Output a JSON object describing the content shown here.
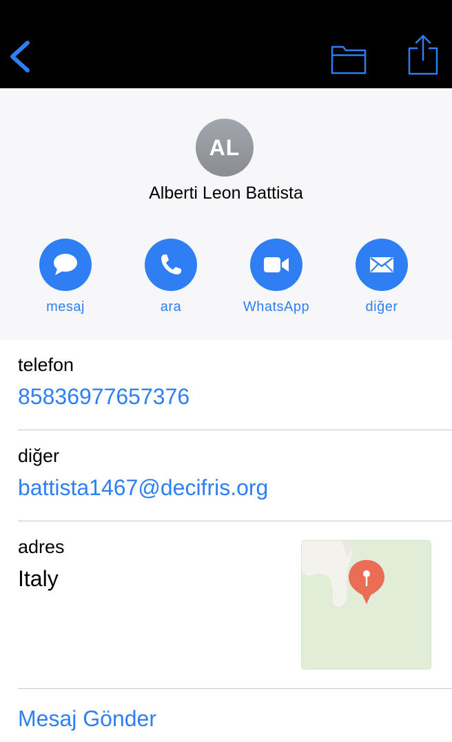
{
  "nav": {
    "back_icon": "chevron-left-icon",
    "folder_icon": "folder-icon",
    "share_icon": "share-icon",
    "accent": "#2f7ff4"
  },
  "contact": {
    "initials": "AL",
    "name": "Alberti Leon Battista"
  },
  "actions": [
    {
      "label": "mesaj",
      "icon": "message-bubble-icon"
    },
    {
      "label": "ara",
      "icon": "phone-icon"
    },
    {
      "label": "WhatsApp",
      "icon": "video-camera-icon"
    },
    {
      "label": "diğer",
      "icon": "envelope-icon"
    }
  ],
  "fields": {
    "phone": {
      "label": "telefon",
      "value": "85836977657376"
    },
    "other": {
      "label": "diğer",
      "value": "battista1467@decifris.org"
    },
    "address": {
      "label": "adres",
      "value": "Italy",
      "map_icon": "map-pin-icon"
    }
  },
  "send_message": "Mesaj Gönder"
}
